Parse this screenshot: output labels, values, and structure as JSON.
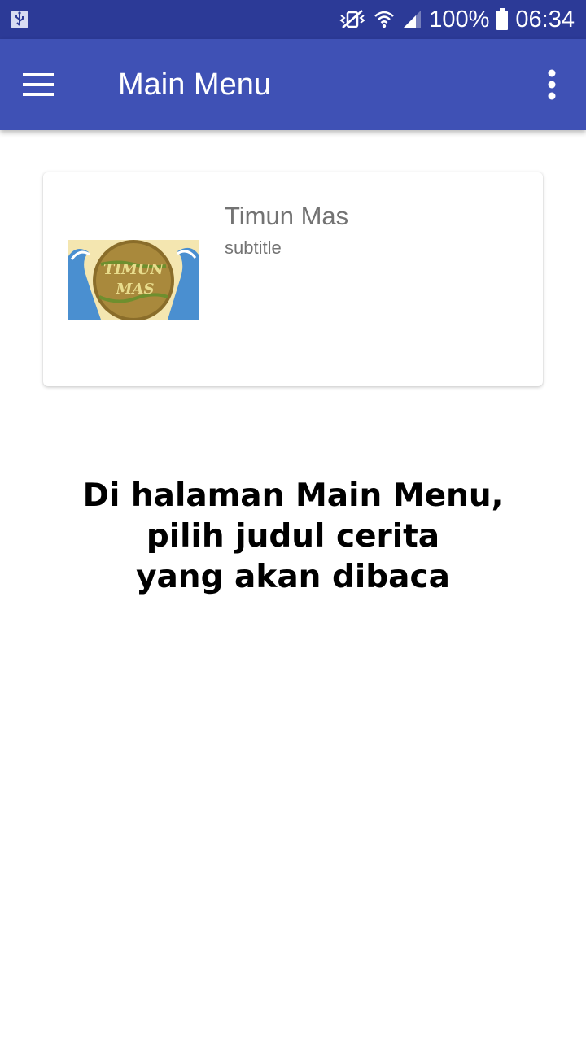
{
  "status_bar": {
    "battery": "100%",
    "time": "06:34",
    "icons": [
      "usb-icon",
      "mute-vibrate-icon",
      "wifi-icon",
      "signal-icon",
      "battery-icon"
    ]
  },
  "app_bar": {
    "title": "Main Menu",
    "menu_icon": "hamburger-menu-icon",
    "overflow_icon": "more-vert-icon",
    "color": "#3f51b5"
  },
  "story_list": [
    {
      "title": "Timun Mas",
      "subtitle": "subtitle",
      "thumbnail_text": "TIMUN MAS"
    }
  ],
  "caption": {
    "line1": "Di halaman Main Menu,",
    "line2": "pilih judul cerita",
    "line3": "yang akan dibaca"
  }
}
